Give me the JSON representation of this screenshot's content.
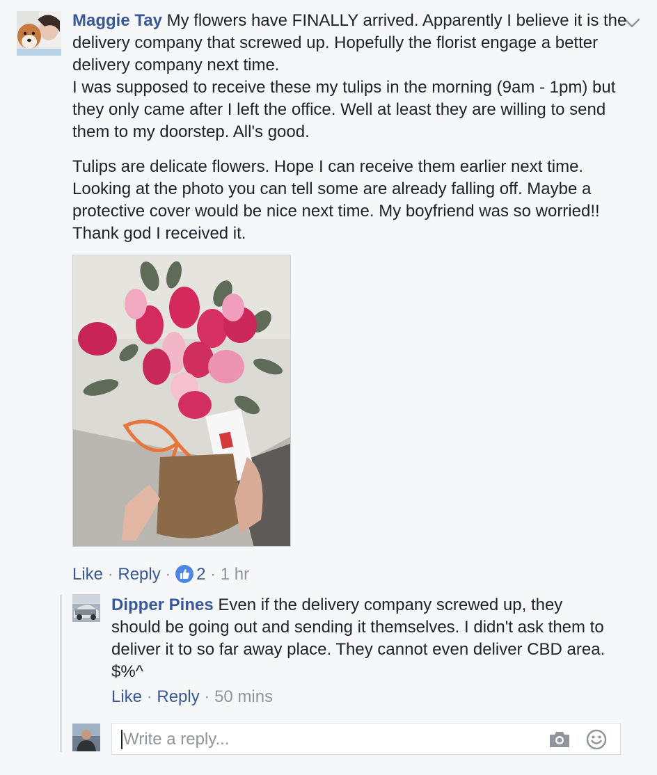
{
  "comment": {
    "author": "Maggie Tay",
    "paragraphs": [
      "My flowers have FINALLY arrived. Apparently I believe it is the delivery company that screwed up. Hopefully the florist engage a better delivery company next time.",
      "I was supposed to receive these my tulips in the morning (9am - 1pm) but they only came after I left the office. Well at least they are willing to send them to my doorstep. All's good.",
      "Tulips are delicate flowers. Hope I can receive them earlier next time. Looking at the photo you can tell some are already falling off. Maybe a protective cover would be nice next time. My boyfriend was so worried!! Thank god I received it."
    ],
    "actions": {
      "like": "Like",
      "reply": "Reply",
      "reaction_count": "2",
      "time": "1 hr",
      "separator": "·"
    }
  },
  "reply": {
    "author": "Dipper Pines",
    "text": "Even if the delivery company screwed up, they should be going out and sending it themselves. I didn't ask them to deliver it to so far away place. They cannot even deliver CBD area. $%^",
    "actions": {
      "like": "Like",
      "reply": "Reply",
      "time": "50 mins",
      "separator": "·"
    }
  },
  "composer": {
    "placeholder": "Write a reply..."
  },
  "icons": {
    "options": "chevron-down-icon",
    "reaction": "thumbs-up-icon",
    "camera": "camera-icon",
    "emoji": "smile-icon"
  },
  "colors": {
    "link": "#385898",
    "meta": "#90949c",
    "reaction": "#4f86e6",
    "background": "#f6f7f9"
  }
}
